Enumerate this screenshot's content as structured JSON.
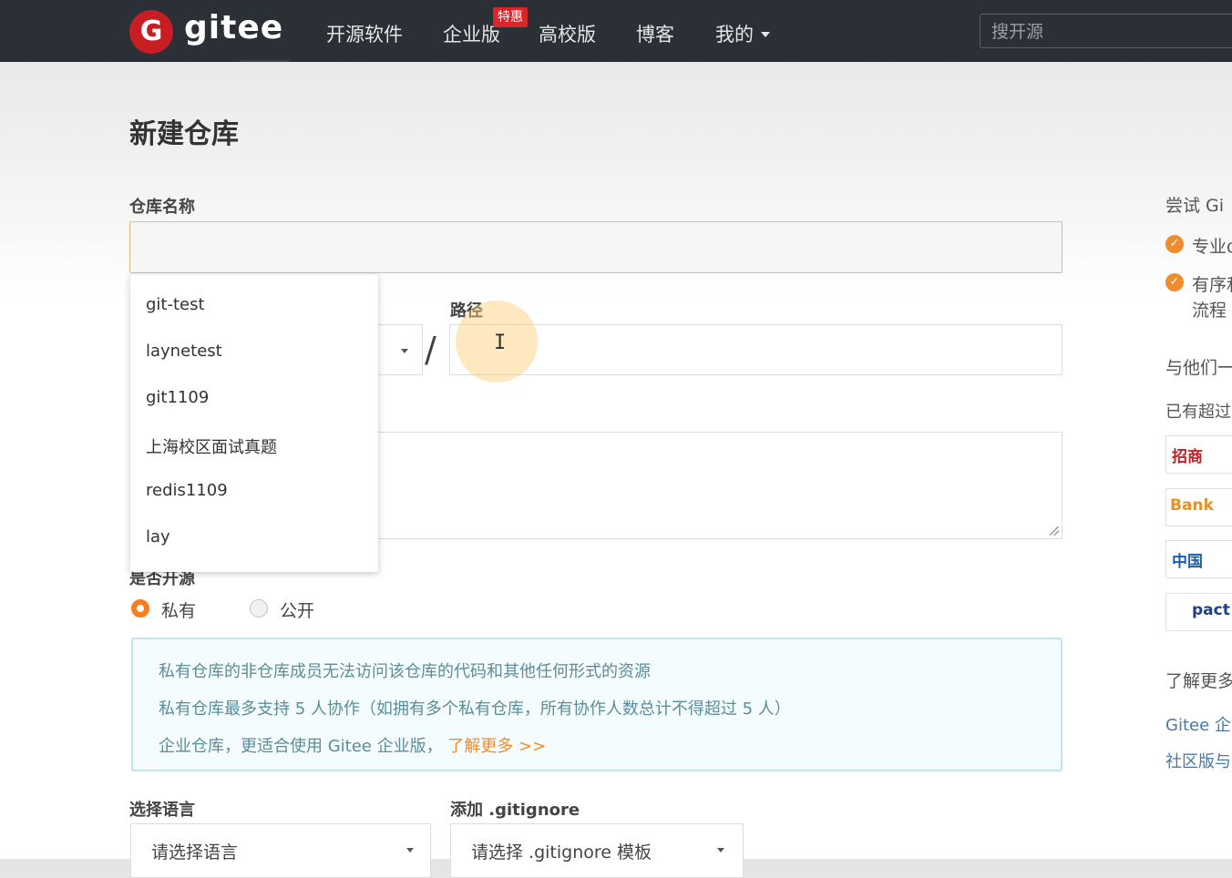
{
  "nav": {
    "logo_letter": "G",
    "brand": "gitee",
    "items": [
      "开源软件",
      "企业版",
      "高校版",
      "博客",
      "我的"
    ],
    "badge": "特惠",
    "search_placeholder": "搜开源"
  },
  "form": {
    "title": "新建仓库",
    "name_label": "仓库名称",
    "path_label": "路径",
    "slash": "/",
    "suggestions": [
      "git-test",
      "laynetest",
      "git1109",
      "上海校区面试真题",
      "redis1109",
      "lay"
    ],
    "visibility_label": "是否开源",
    "visibility_options": [
      "私有",
      "公开"
    ],
    "visibility_selected": "私有",
    "info_lines": [
      "私有仓库的非仓库成员无法访问该仓库的代码和其他任何形式的资源",
      "私有仓库最多支持 5 人协作（如拥有多个私有仓库，所有协作人数总计不得超过 5 人）",
      "企业仓库，更适合使用 Gitee 企业版，"
    ],
    "info_link": "了解更多 >>",
    "language_label": "选择语言",
    "language_placeholder": "请选择语言",
    "gitignore_label": "添加 .gitignore",
    "gitignore_placeholder": "请选择 .gitignore 模板"
  },
  "sidebar": {
    "try_title": "尝试 Gi",
    "checks": [
      "专业α",
      "有序和",
      "流程"
    ],
    "with_them": "与他们一",
    "already": "已有超过",
    "company_logos": [
      "招商",
      "Bank",
      "中国",
      "pact"
    ],
    "learn_more": "了解更多",
    "links": [
      "Gitee 企",
      "社区版与"
    ]
  },
  "colors": {
    "topbar": "#2b3037",
    "brand_red": "#c71d23",
    "accent_orange": "#fa7d1e",
    "info_text": "#5a8d9a",
    "link_blue": "#4a78a8"
  }
}
